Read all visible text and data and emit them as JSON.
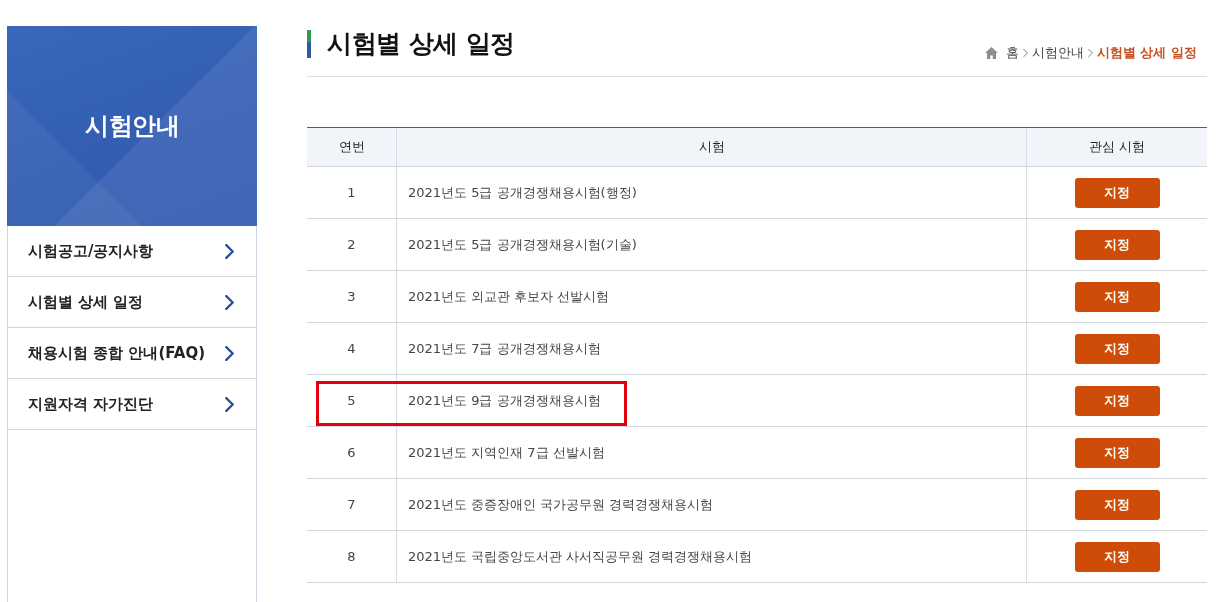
{
  "sidebar": {
    "title": "시험안내",
    "items": [
      {
        "label": "시험공고/공지사항"
      },
      {
        "label": "시험별 상세 일정"
      },
      {
        "label": "채용시험 종합 안내(FAQ)"
      },
      {
        "label": "지원자격 자가진단"
      }
    ]
  },
  "page": {
    "title": "시험별 상세 일정",
    "breadcrumb": [
      {
        "label": "홈",
        "current": false
      },
      {
        "label": "시험안내",
        "current": false
      },
      {
        "label": "시험별 상세 일정",
        "current": true
      }
    ]
  },
  "table": {
    "columns": [
      "연번",
      "시험",
      "관심 시험"
    ],
    "rows": [
      {
        "no": "1",
        "exam": "2021년도 5급 공개경쟁채용시험(행정)",
        "action": "지정",
        "highlighted": false
      },
      {
        "no": "2",
        "exam": "2021년도 5급 공개경쟁채용시험(기술)",
        "action": "지정",
        "highlighted": false
      },
      {
        "no": "3",
        "exam": "2021년도 외교관 후보자 선발시험",
        "action": "지정",
        "highlighted": false
      },
      {
        "no": "4",
        "exam": "2021년도 7급 공개경쟁채용시험",
        "action": "지정",
        "highlighted": false
      },
      {
        "no": "5",
        "exam": "2021년도 9급 공개경쟁채용시험",
        "action": "지정",
        "highlighted": true
      },
      {
        "no": "6",
        "exam": "2021년도 지역인재 7급 선발시험",
        "action": "지정",
        "highlighted": false
      },
      {
        "no": "7",
        "exam": "2021년도 중증장애인 국가공무원 경력경쟁채용시험",
        "action": "지정",
        "highlighted": false
      },
      {
        "no": "8",
        "exam": "2021년도 국립중앙도서관 사서직공무원 경력경쟁채용시험",
        "action": "지정",
        "highlighted": false
      }
    ]
  }
}
